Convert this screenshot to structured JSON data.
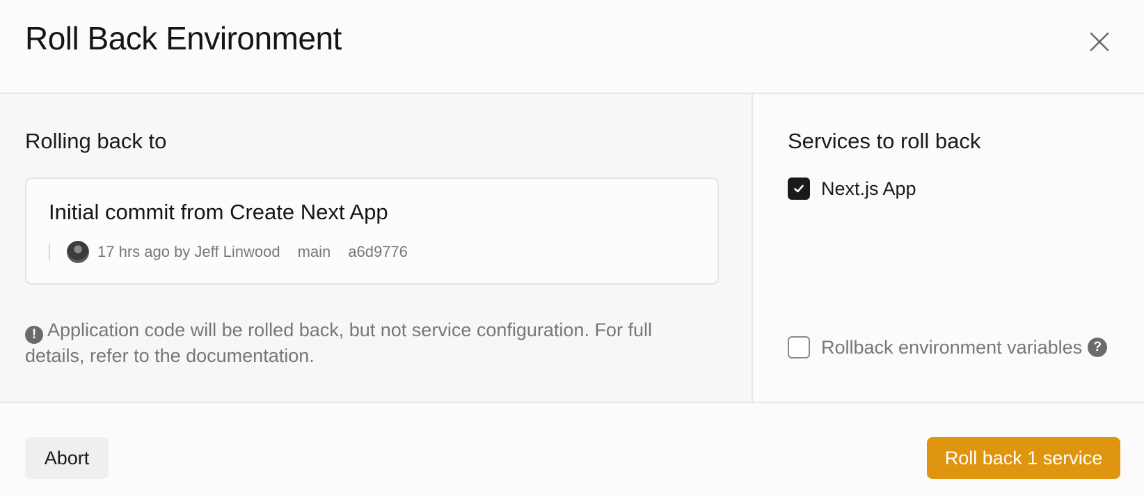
{
  "dialog": {
    "title": "Roll Back Environment",
    "close_icon": "close-icon"
  },
  "rolling_back": {
    "heading": "Rolling back to",
    "commit": {
      "message": "Initial commit from Create Next App",
      "time_author": "17 hrs ago by Jeff Linwood",
      "branch": "main",
      "hash": "a6d9776"
    },
    "notice_icon": "exclamation-circle-icon",
    "notice": "Application code will be rolled back, but not service configuration. For full details, refer to the documentation."
  },
  "services": {
    "heading": "Services to roll back",
    "items": [
      {
        "label": "Next.js App",
        "checked": true
      }
    ],
    "env_vars": {
      "label": "Rollback environment variables",
      "checked": false,
      "help_icon": "question-circle-icon"
    }
  },
  "footer": {
    "abort_label": "Abort",
    "rollback_label": "Roll back 1 service"
  },
  "colors": {
    "primary_button": "#df9510",
    "checkbox_checked": "#1a1a1a",
    "muted_text": "#777777"
  }
}
